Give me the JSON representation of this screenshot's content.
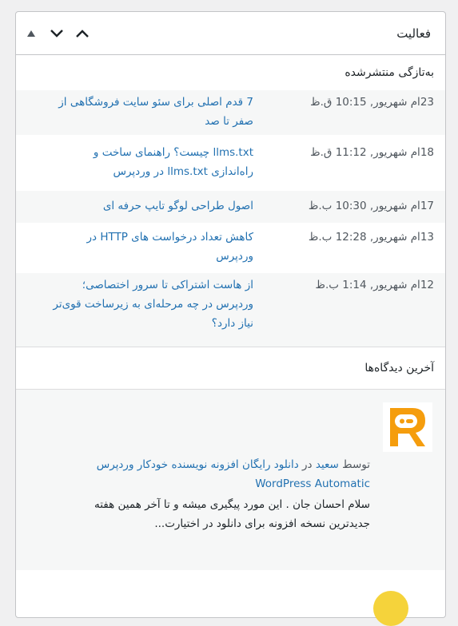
{
  "widget": {
    "title": "فعالیت",
    "controls": [
      "chevron-up",
      "chevron-down",
      "triangle-up"
    ]
  },
  "recent_posts": {
    "heading": "به‌تازگی منتشرشده",
    "items": [
      {
        "date": "23ام شهریور, 10:15 ق.ظ",
        "title_line1": "7 قدم اصلی برای سئو سایت فروشگاهی از",
        "title_line2": "صفر تا صد"
      },
      {
        "date": "18ام شهریور, 11:12 ق.ظ",
        "title_line1": "llms.txt چیست؟ راهنمای ساخت و",
        "title_line2": "راه‌اندازی llms.txt در وردپرس"
      },
      {
        "date": "17ام شهریور, 10:30 ب.ظ",
        "title_line1": "اصول طراحی لوگو تایپ حرفه ای",
        "title_line2": ""
      },
      {
        "date": "13ام شهریور, 12:28 ب.ظ",
        "title_line1": "کاهش تعداد درخواست های HTTP در",
        "title_line2": "وردپرس"
      },
      {
        "date": "12ام شهریور, 1:14 ب.ظ",
        "title_line1": "از هاست اشتراکی تا سرور اختصاصی؛",
        "title_line2": "وردپرس در چه مرحله‌ای به زیرساخت قوی‌تر",
        "title_line3": "نیاز دارد؟"
      }
    ]
  },
  "recent_comments": {
    "heading": "آخرین دیدگاه‌ها",
    "comment": {
      "by_label": "توسط",
      "author": "سعید",
      "in_label": "در",
      "post_link_line1": "دانلود رایگان افزونه نویسنده خودکار وردپرس",
      "post_link_line2": "WordPress Automatic",
      "text_line1": "سلام احسان جان . این مورد پیگیری میشه و تا آخر همین هفته",
      "text_line2": "جدیدترین نسخه افزونه برای دانلود در اختیارت..."
    }
  },
  "colors": {
    "link": "#2271b1",
    "text": "#1d2327",
    "muted": "#50575e",
    "alt_row": "#f6f7f7",
    "avatar_orange": "#f59d0d"
  }
}
